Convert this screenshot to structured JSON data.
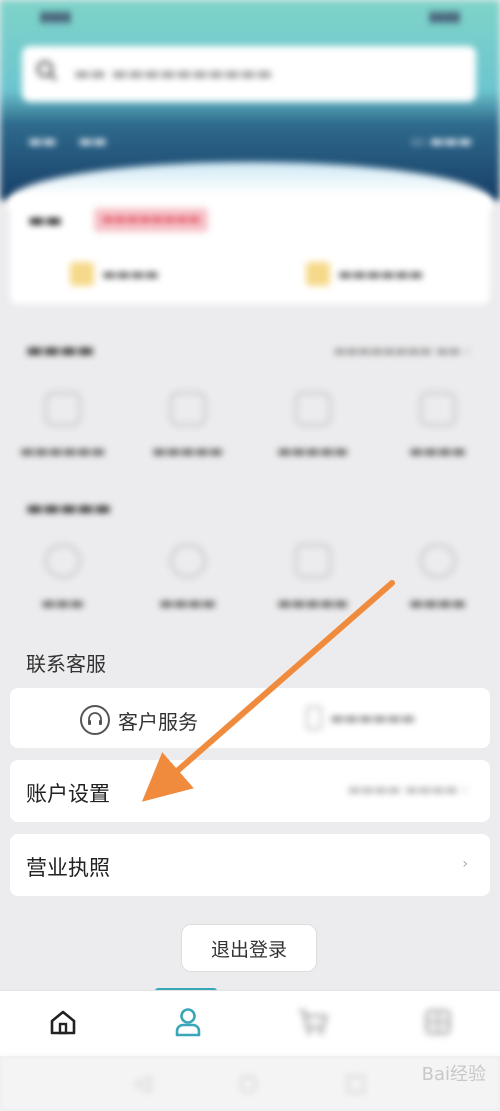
{
  "contact_service": {
    "section_title": "联系客服",
    "customer_service_label": "客户服务"
  },
  "account_settings": {
    "label": "账户设置"
  },
  "business_license": {
    "label": "营业执照"
  },
  "logout": {
    "label": "退出登录"
  },
  "colors": {
    "arrow": "#f08a3c",
    "tab_active": "#3aa7b8"
  },
  "icons": {
    "tab_home": "home-icon",
    "tab_profile": "user-icon",
    "tab_cart": "cart-icon",
    "tab_more": "grid-icon",
    "customer_service": "headset-icon"
  },
  "watermark": "Bai经验"
}
